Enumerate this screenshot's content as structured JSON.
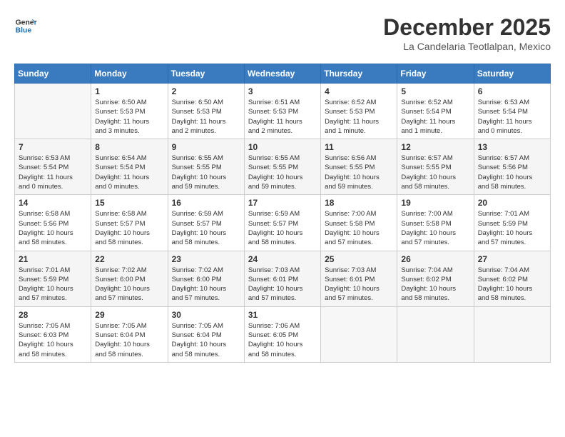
{
  "header": {
    "logo_line1": "General",
    "logo_line2": "Blue",
    "month": "December 2025",
    "location": "La Candelaria Teotlalpan, Mexico"
  },
  "days_of_week": [
    "Sunday",
    "Monday",
    "Tuesday",
    "Wednesday",
    "Thursday",
    "Friday",
    "Saturday"
  ],
  "weeks": [
    [
      {
        "day": "",
        "info": ""
      },
      {
        "day": "1",
        "info": "Sunrise: 6:50 AM\nSunset: 5:53 PM\nDaylight: 11 hours\nand 3 minutes."
      },
      {
        "day": "2",
        "info": "Sunrise: 6:50 AM\nSunset: 5:53 PM\nDaylight: 11 hours\nand 2 minutes."
      },
      {
        "day": "3",
        "info": "Sunrise: 6:51 AM\nSunset: 5:53 PM\nDaylight: 11 hours\nand 2 minutes."
      },
      {
        "day": "4",
        "info": "Sunrise: 6:52 AM\nSunset: 5:53 PM\nDaylight: 11 hours\nand 1 minute."
      },
      {
        "day": "5",
        "info": "Sunrise: 6:52 AM\nSunset: 5:54 PM\nDaylight: 11 hours\nand 1 minute."
      },
      {
        "day": "6",
        "info": "Sunrise: 6:53 AM\nSunset: 5:54 PM\nDaylight: 11 hours\nand 0 minutes."
      }
    ],
    [
      {
        "day": "7",
        "info": "Sunrise: 6:53 AM\nSunset: 5:54 PM\nDaylight: 11 hours\nand 0 minutes."
      },
      {
        "day": "8",
        "info": "Sunrise: 6:54 AM\nSunset: 5:54 PM\nDaylight: 11 hours\nand 0 minutes."
      },
      {
        "day": "9",
        "info": "Sunrise: 6:55 AM\nSunset: 5:55 PM\nDaylight: 10 hours\nand 59 minutes."
      },
      {
        "day": "10",
        "info": "Sunrise: 6:55 AM\nSunset: 5:55 PM\nDaylight: 10 hours\nand 59 minutes."
      },
      {
        "day": "11",
        "info": "Sunrise: 6:56 AM\nSunset: 5:55 PM\nDaylight: 10 hours\nand 59 minutes."
      },
      {
        "day": "12",
        "info": "Sunrise: 6:57 AM\nSunset: 5:55 PM\nDaylight: 10 hours\nand 58 minutes."
      },
      {
        "day": "13",
        "info": "Sunrise: 6:57 AM\nSunset: 5:56 PM\nDaylight: 10 hours\nand 58 minutes."
      }
    ],
    [
      {
        "day": "14",
        "info": "Sunrise: 6:58 AM\nSunset: 5:56 PM\nDaylight: 10 hours\nand 58 minutes."
      },
      {
        "day": "15",
        "info": "Sunrise: 6:58 AM\nSunset: 5:57 PM\nDaylight: 10 hours\nand 58 minutes."
      },
      {
        "day": "16",
        "info": "Sunrise: 6:59 AM\nSunset: 5:57 PM\nDaylight: 10 hours\nand 58 minutes."
      },
      {
        "day": "17",
        "info": "Sunrise: 6:59 AM\nSunset: 5:57 PM\nDaylight: 10 hours\nand 58 minutes."
      },
      {
        "day": "18",
        "info": "Sunrise: 7:00 AM\nSunset: 5:58 PM\nDaylight: 10 hours\nand 57 minutes."
      },
      {
        "day": "19",
        "info": "Sunrise: 7:00 AM\nSunset: 5:58 PM\nDaylight: 10 hours\nand 57 minutes."
      },
      {
        "day": "20",
        "info": "Sunrise: 7:01 AM\nSunset: 5:59 PM\nDaylight: 10 hours\nand 57 minutes."
      }
    ],
    [
      {
        "day": "21",
        "info": "Sunrise: 7:01 AM\nSunset: 5:59 PM\nDaylight: 10 hours\nand 57 minutes."
      },
      {
        "day": "22",
        "info": "Sunrise: 7:02 AM\nSunset: 6:00 PM\nDaylight: 10 hours\nand 57 minutes."
      },
      {
        "day": "23",
        "info": "Sunrise: 7:02 AM\nSunset: 6:00 PM\nDaylight: 10 hours\nand 57 minutes."
      },
      {
        "day": "24",
        "info": "Sunrise: 7:03 AM\nSunset: 6:01 PM\nDaylight: 10 hours\nand 57 minutes."
      },
      {
        "day": "25",
        "info": "Sunrise: 7:03 AM\nSunset: 6:01 PM\nDaylight: 10 hours\nand 57 minutes."
      },
      {
        "day": "26",
        "info": "Sunrise: 7:04 AM\nSunset: 6:02 PM\nDaylight: 10 hours\nand 58 minutes."
      },
      {
        "day": "27",
        "info": "Sunrise: 7:04 AM\nSunset: 6:02 PM\nDaylight: 10 hours\nand 58 minutes."
      }
    ],
    [
      {
        "day": "28",
        "info": "Sunrise: 7:05 AM\nSunset: 6:03 PM\nDaylight: 10 hours\nand 58 minutes."
      },
      {
        "day": "29",
        "info": "Sunrise: 7:05 AM\nSunset: 6:04 PM\nDaylight: 10 hours\nand 58 minutes."
      },
      {
        "day": "30",
        "info": "Sunrise: 7:05 AM\nSunset: 6:04 PM\nDaylight: 10 hours\nand 58 minutes."
      },
      {
        "day": "31",
        "info": "Sunrise: 7:06 AM\nSunset: 6:05 PM\nDaylight: 10 hours\nand 58 minutes."
      },
      {
        "day": "",
        "info": ""
      },
      {
        "day": "",
        "info": ""
      },
      {
        "day": "",
        "info": ""
      }
    ]
  ]
}
